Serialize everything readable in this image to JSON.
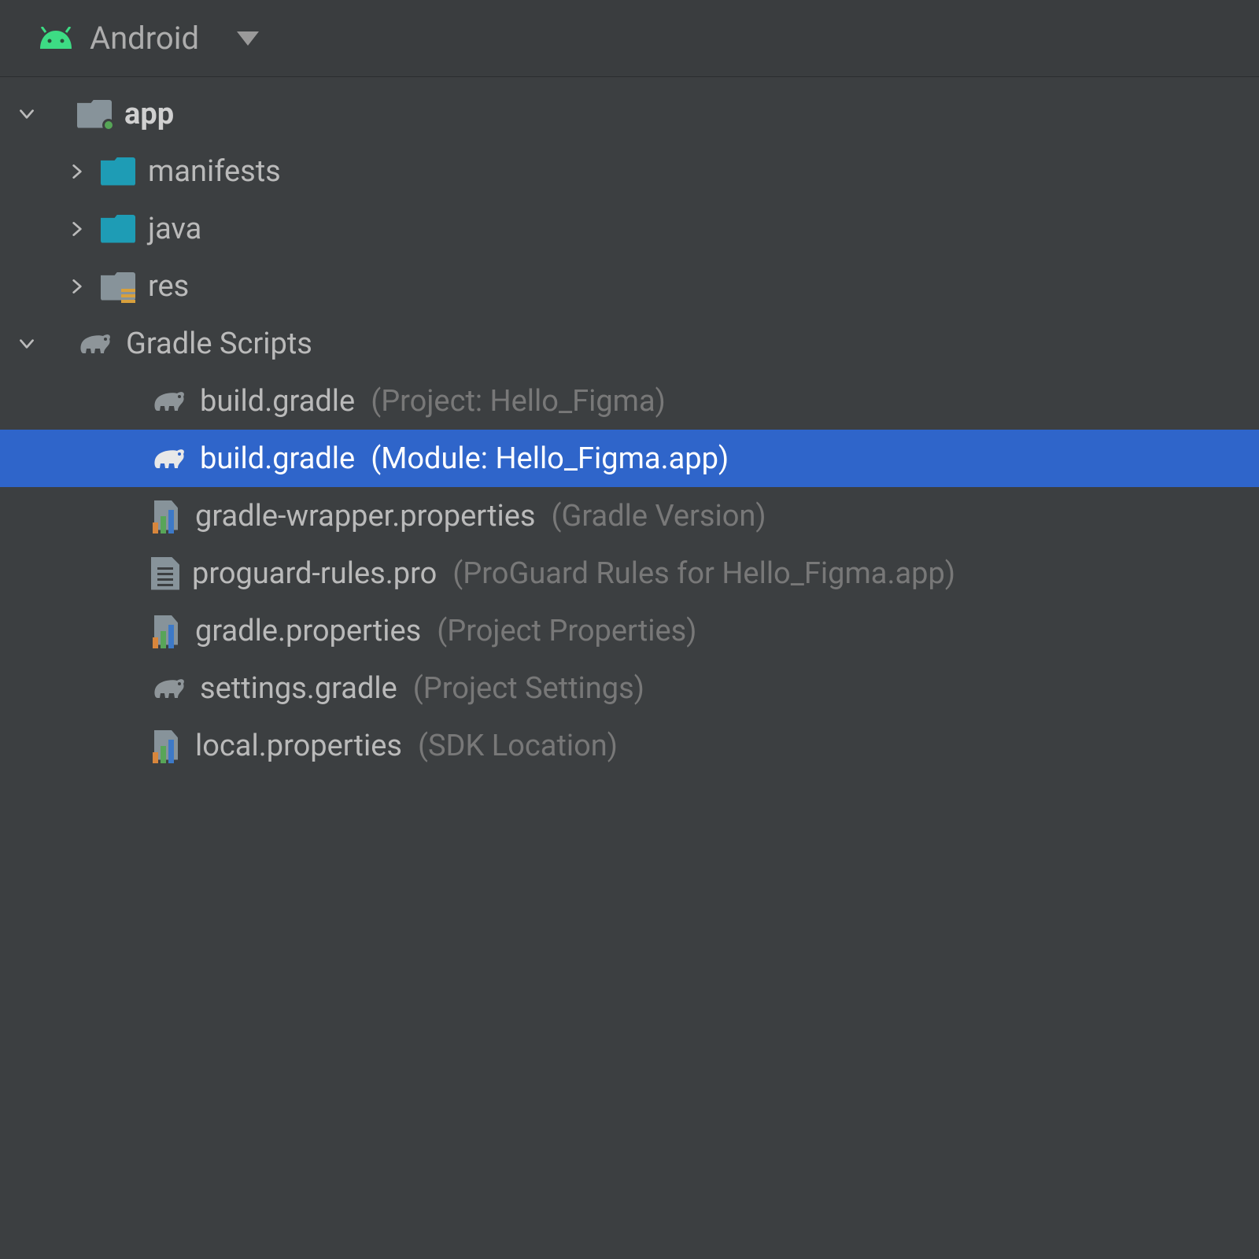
{
  "header": {
    "label": "Android"
  },
  "tree": {
    "app": {
      "label": "app"
    },
    "manifests": {
      "label": "manifests"
    },
    "java": {
      "label": "java"
    },
    "res": {
      "label": "res"
    },
    "gradle_scripts": {
      "label": "Gradle Scripts"
    },
    "items": [
      {
        "name": "build.gradle",
        "detail": "(Project: Hello_Figma)",
        "icon": "elephant",
        "selected": false
      },
      {
        "name": "build.gradle",
        "detail": "(Module: Hello_Figma.app)",
        "icon": "elephant",
        "selected": true
      },
      {
        "name": "gradle-wrapper.properties",
        "detail": "(Gradle Version)",
        "icon": "props",
        "selected": false
      },
      {
        "name": "proguard-rules.pro",
        "detail": "(ProGuard Rules for Hello_Figma.app)",
        "icon": "textfile",
        "selected": false
      },
      {
        "name": "gradle.properties",
        "detail": "(Project Properties)",
        "icon": "props",
        "selected": false
      },
      {
        "name": "settings.gradle",
        "detail": "(Project Settings)",
        "icon": "elephant",
        "selected": false
      },
      {
        "name": "local.properties",
        "detail": "(SDK Location)",
        "icon": "props",
        "selected": false
      }
    ]
  }
}
